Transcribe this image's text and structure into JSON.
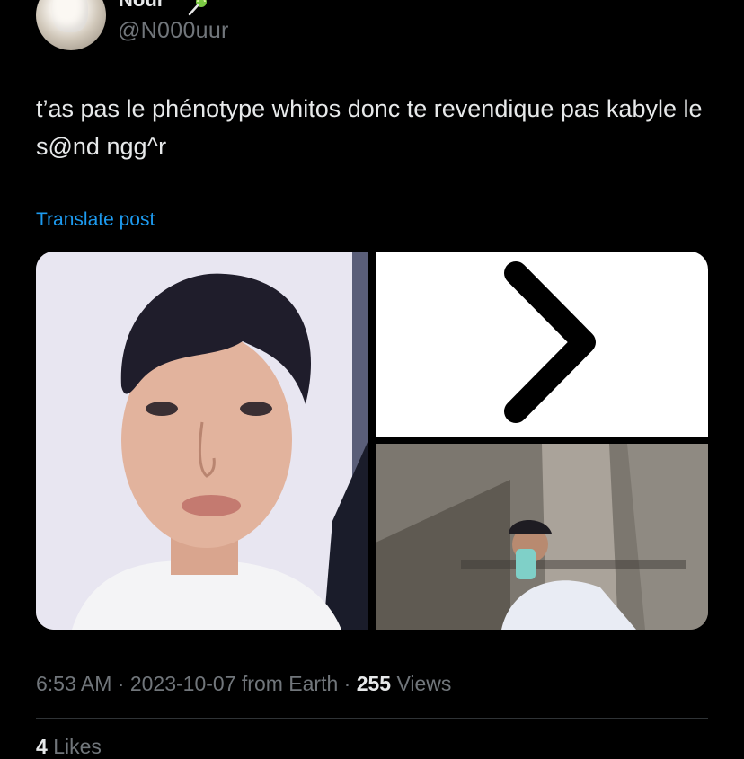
{
  "author": {
    "name": "Nour",
    "handle": "@N000uur",
    "avatar": "bunny-avatar",
    "badge_icon": "lollipop-emoji-icon"
  },
  "post": {
    "text": "t’as pas le phénotype whitos donc te revendique pas kabyle le s@nd ngg^r",
    "translate_label": "Translate post"
  },
  "media": [
    {
      "kind": "selfie-photo"
    },
    {
      "kind": "chevron-right-image"
    },
    {
      "kind": "elevator-mirror-selfie-photo"
    }
  ],
  "meta": {
    "time": "6:53 AM",
    "date": "2023-10-07",
    "source": "from Earth",
    "views_count": "255",
    "views_label": "Views",
    "separator": "·"
  },
  "engagement": {
    "likes_count": "4",
    "likes_label": "Likes"
  },
  "colors": {
    "background": "#000000",
    "text": "#e7e9ea",
    "secondary": "#71767b",
    "link": "#1d9bf0",
    "divider": "#2f3336"
  }
}
